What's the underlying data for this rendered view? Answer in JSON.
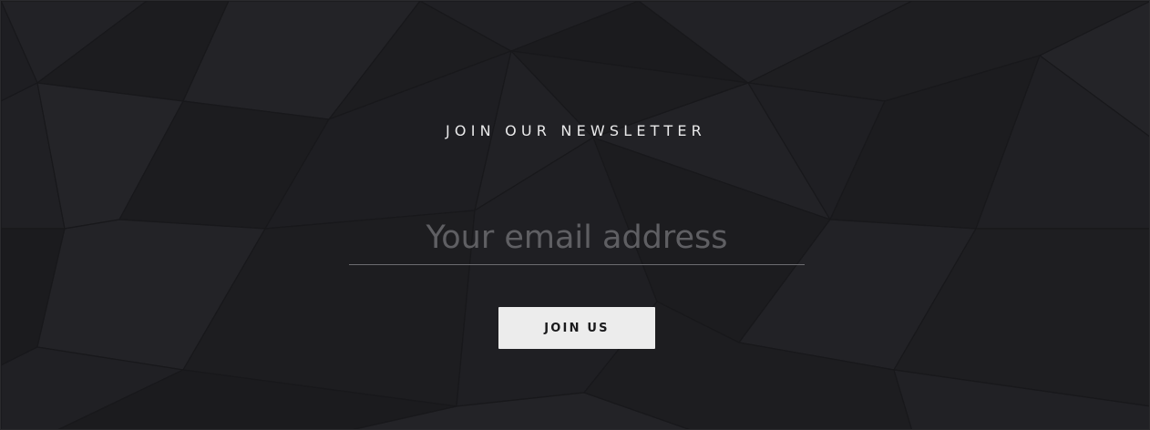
{
  "newsletter": {
    "heading": "JOIN OUR NEWSLETTER",
    "email_placeholder": "Your email address",
    "email_value": "",
    "button_label": "JOIN US"
  },
  "colors": {
    "background": "#1f1f22",
    "heading_text": "#e9e9ea",
    "placeholder_text": "#5f5f63",
    "input_underline": "#6c6c70",
    "button_background": "#ececec",
    "button_text": "#1a1a1c"
  }
}
